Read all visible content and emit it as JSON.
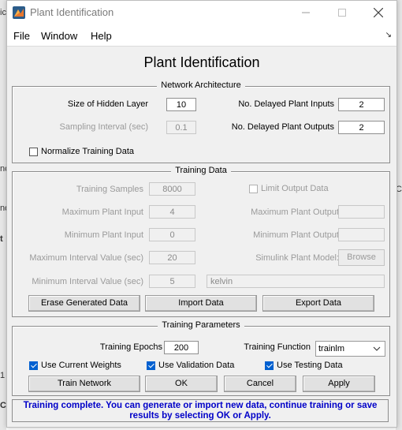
{
  "window": {
    "title": "Plant Identification",
    "buttons": {
      "minimize": "—",
      "maximize": "☐",
      "close": "✕"
    }
  },
  "menu": {
    "items": [
      "File",
      "Window",
      "Help"
    ],
    "dock": "↘"
  },
  "heading": "Plant Identification",
  "network": {
    "title": "Network Architecture",
    "hidden_label": "Size of Hidden Layer",
    "hidden_value": "10",
    "sampling_label": "Sampling Interval (sec)",
    "sampling_value": "0.1",
    "normalize_label": "Normalize Training Data",
    "normalize_checked": false,
    "inputs_label": "No. Delayed Plant Inputs",
    "inputs_value": "2",
    "outputs_label": "No. Delayed Plant Outputs",
    "outputs_value": "2"
  },
  "training_data": {
    "title": "Training Data",
    "samples_label": "Training Samples",
    "samples_value": "8000",
    "max_input_label": "Maximum Plant Input",
    "max_input_value": "4",
    "min_input_label": "Minimum Plant Input",
    "min_input_value": "0",
    "max_interval_label": "Maximum Interval Value (sec)",
    "max_interval_value": "20",
    "min_interval_label": "Minimum Interval Value (sec)",
    "min_interval_value": "5",
    "limit_output_label": "Limit Output Data",
    "max_output_label": "Maximum Plant Output",
    "max_output_value": "",
    "min_output_label": "Minimum Plant Output",
    "min_output_value": "",
    "simulink_label": "Simulink Plant Model:",
    "browse_label": "Browse",
    "model_value": "kelvin",
    "erase_label": "Erase Generated Data",
    "import_label": "Import Data",
    "export_label": "Export Data"
  },
  "training_params": {
    "title": "Training Parameters",
    "epochs_label": "Training Epochs",
    "epochs_value": "200",
    "function_label": "Training Function",
    "function_value": "trainlm",
    "use_current_weights": "Use Current Weights",
    "use_validation": "Use Validation Data",
    "use_testing": "Use Testing Data",
    "train_label": "Train Network",
    "ok_label": "OK",
    "cancel_label": "Cancel",
    "apply_label": "Apply"
  },
  "status": "Training complete. You can generate or import new data, continue training or save results by selecting OK or Apply.",
  "colors": {
    "status_text": "#0000c8",
    "checkbox_on": "#0060d0",
    "window_bg": "#f0f0f0"
  },
  "background": {
    "frags": [
      "ic",
      "nc",
      "nd",
      "t",
      "Co",
      "1",
      "C"
    ]
  }
}
